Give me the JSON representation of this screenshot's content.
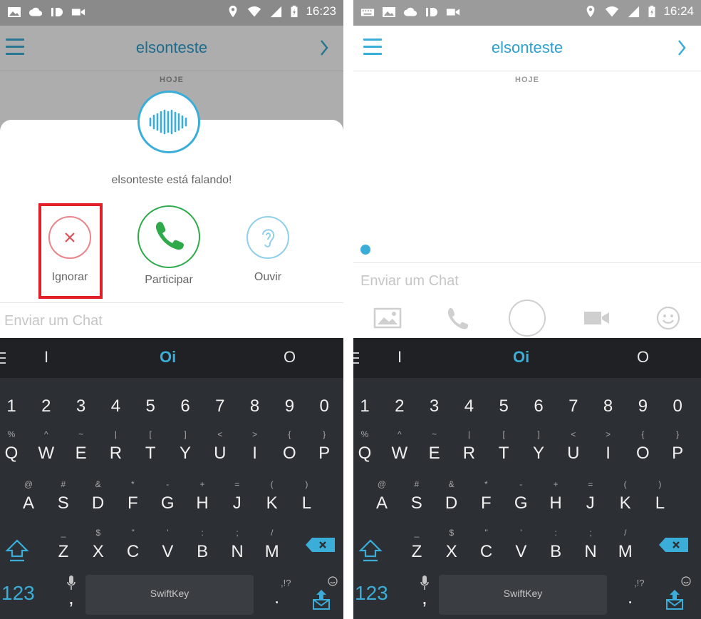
{
  "left": {
    "status_time": "16:23",
    "header_title": "elsonteste",
    "day_label": "HOJE",
    "talk_message": "elsonteste está falando!",
    "actions": [
      {
        "label": "Ignorar",
        "icon": "close-icon"
      },
      {
        "label": "Participar",
        "icon": "phone-icon"
      },
      {
        "label": "Ouvir",
        "icon": "ear-icon"
      }
    ],
    "chat_placeholder": "Enviar um Chat"
  },
  "right": {
    "status_time": "16:24",
    "header_title": "elsonteste",
    "day_label": "HOJE",
    "chat_placeholder": "Enviar um Chat",
    "toolbar": [
      "image-icon",
      "phone-icon",
      "capture-button",
      "video-icon",
      "smiley-icon"
    ]
  },
  "keyboard": {
    "suggestions": [
      "I",
      "Oi",
      "O"
    ],
    "number_row": [
      "1",
      "2",
      "3",
      "4",
      "5",
      "6",
      "7",
      "8",
      "9",
      "0"
    ],
    "row1": [
      {
        "k": "Q",
        "a": "%"
      },
      {
        "k": "W",
        "a": "^"
      },
      {
        "k": "E",
        "a": "~"
      },
      {
        "k": "R",
        "a": "|"
      },
      {
        "k": "T",
        "a": "["
      },
      {
        "k": "Y",
        "a": "]"
      },
      {
        "k": "U",
        "a": "<"
      },
      {
        "k": "I",
        "a": ">"
      },
      {
        "k": "O",
        "a": "{"
      },
      {
        "k": "P",
        "a": "}"
      }
    ],
    "row2": [
      {
        "k": "A",
        "a": "@"
      },
      {
        "k": "S",
        "a": "#"
      },
      {
        "k": "D",
        "a": "&"
      },
      {
        "k": "F",
        "a": "*"
      },
      {
        "k": "G",
        "a": "-"
      },
      {
        "k": "H",
        "a": "+"
      },
      {
        "k": "J",
        "a": "="
      },
      {
        "k": "K",
        "a": "("
      },
      {
        "k": "L",
        "a": ")"
      }
    ],
    "row3": [
      {
        "k": "Z",
        "a": "_"
      },
      {
        "k": "X",
        "a": "$"
      },
      {
        "k": "C",
        "a": "\""
      },
      {
        "k": "V",
        "a": "'"
      },
      {
        "k": "B",
        "a": ":"
      },
      {
        "k": "N",
        "a": ";"
      },
      {
        "k": "M",
        "a": "/"
      }
    ],
    "num_key": "123",
    "comma": ",",
    "space_brand": "SwiftKey",
    "punct_main": ".",
    "punct_alt": ",!?",
    "accent": "#3aaed8"
  }
}
